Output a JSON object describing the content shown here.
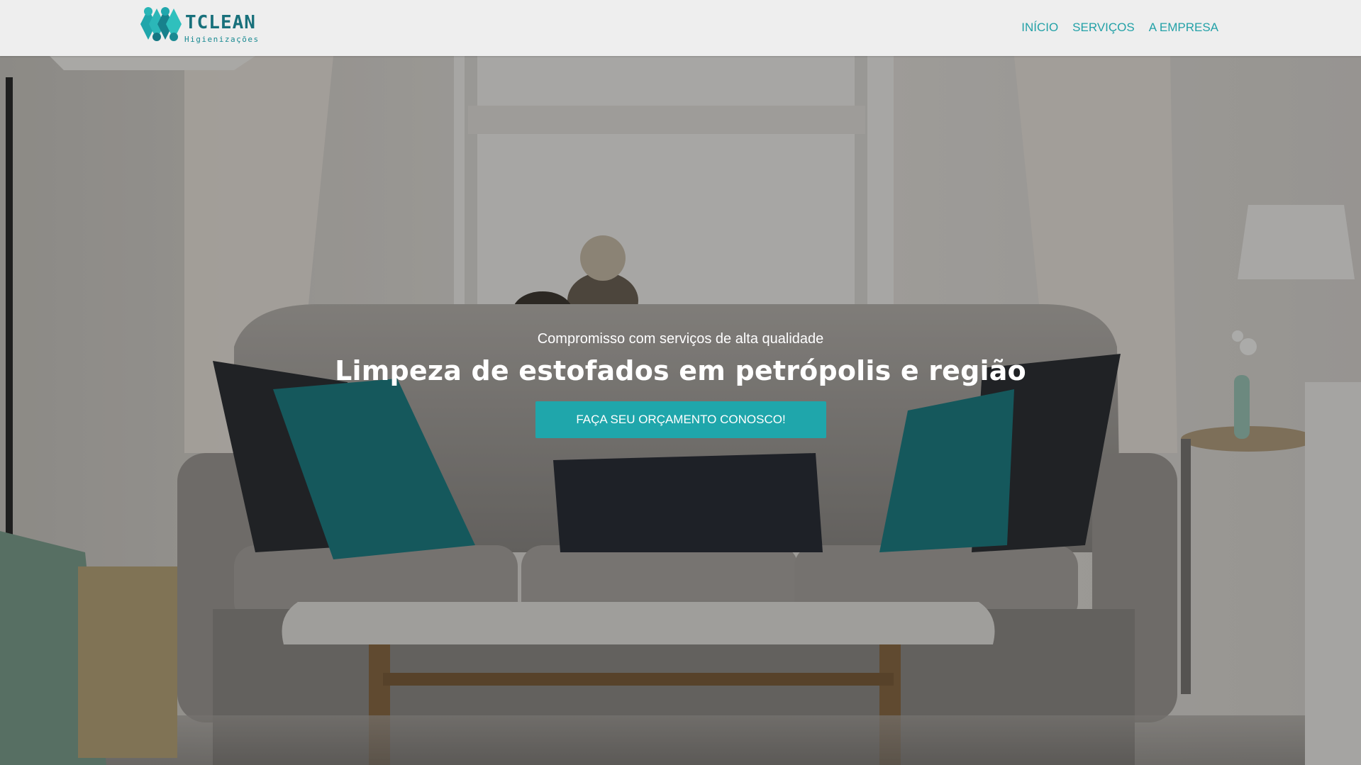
{
  "header": {
    "logo": {
      "name": "TCLEAN",
      "tagline": "Higienizações"
    },
    "nav": [
      "INÍCIO",
      "SERVIÇOS",
      "A EMPRESA"
    ]
  },
  "hero": {
    "subtitle": "Compromisso com serviços de alta qualidade",
    "title": "Limpeza de estofados em petrópolis e região",
    "cta_label": "FAÇA SEU ORÇAMENTO CONOSCO!"
  },
  "colors": {
    "brand_teal": "#1fa6ab",
    "nav_link": "#23a1a7",
    "header_bg": "#eeeeee",
    "logo_dark": "#18707b"
  },
  "icons": [
    "logo-diamond-icon"
  ]
}
